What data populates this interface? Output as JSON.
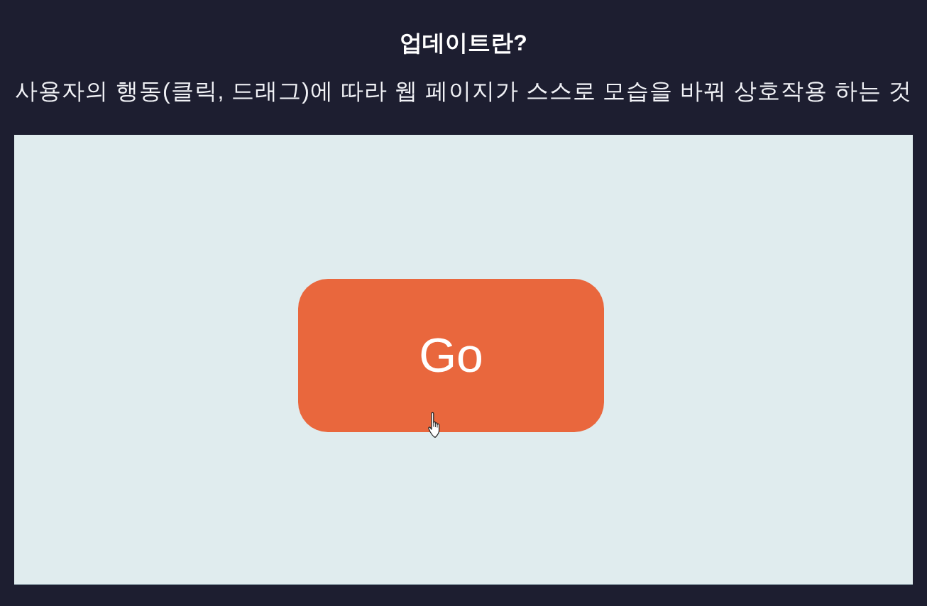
{
  "title": "업데이트란?",
  "subtitle": "사용자의 행동(클릭, 드래그)에 따라 웹 페이지가 스스로 모습을 바꿔 상호작용 하는 것",
  "demo": {
    "button": {
      "label": "Go"
    }
  }
}
